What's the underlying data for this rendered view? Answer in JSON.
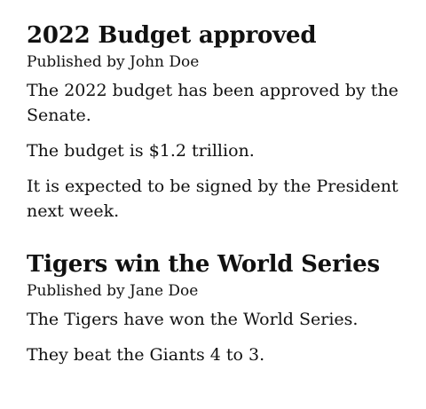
{
  "articles": [
    {
      "title": "2022 Budget approved",
      "byline": "Published by John Doe",
      "paragraphs": [
        "The 2022 budget has been approved by the Senate.",
        "The budget is $1.2 trillion.",
        "It is expected to be signed by the President next week."
      ]
    },
    {
      "title": "Tigers win the World Series",
      "byline": "Published by Jane Doe",
      "paragraphs": [
        "The Tigers have won the World Series.",
        "They beat the Giants 4 to 3."
      ]
    }
  ]
}
